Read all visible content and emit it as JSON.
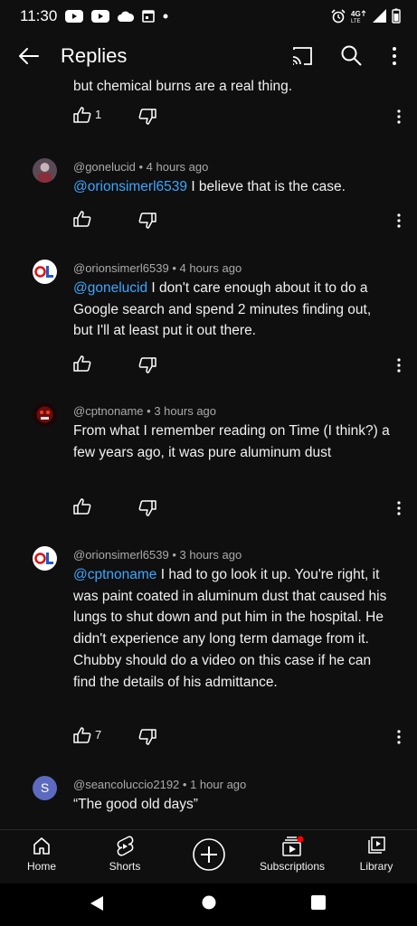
{
  "status_bar": {
    "time": "11:30",
    "network": "4G LTE"
  },
  "header": {
    "title": "Replies"
  },
  "comments": [
    {
      "author": "",
      "age": "",
      "body_parts": [
        {
          "t": "but chemical burns are a real thing.",
          "m": false
        }
      ],
      "likes": "1"
    },
    {
      "author": "@gonelucid",
      "age": "4 hours ago",
      "body_parts": [
        {
          "t": "@orionsimerl6539",
          "m": true
        },
        {
          "t": "  I believe that is the case.",
          "m": false
        }
      ],
      "likes": ""
    },
    {
      "author": "@orionsimerl6539",
      "age": "4 hours ago",
      "body_parts": [
        {
          "t": "@gonelucid",
          "m": true
        },
        {
          "t": "  I don't care enough about it to do a Google search and spend 2 minutes finding out, but I'll at least put it out there.",
          "m": false
        }
      ],
      "likes": ""
    },
    {
      "author": "@cptnoname",
      "age": "3 hours ago",
      "body_parts": [
        {
          "t": "From what I remember reading on Time (I think?) a few years ago, it was pure aluminum dust",
          "m": false
        }
      ],
      "likes": ""
    },
    {
      "author": "@orionsimerl6539",
      "age": "3 hours ago",
      "body_parts": [
        {
          "t": "@cptnoname",
          "m": true
        },
        {
          "t": "  I had to go look it up.  You're right, it was paint coated in aluminum dust that caused his lungs to shut down and put him in the hospital.  He didn't experience any long term damage from it.  Chubby should do a video on this case if he can find the details of his admittance.",
          "m": false
        }
      ],
      "likes": "7"
    },
    {
      "author": "@seancoluccio2192",
      "age": "1 hour ago",
      "body_parts": [
        {
          "t": "“The good old days”",
          "m": false
        }
      ],
      "likes": "",
      "avatar_letter": "S"
    }
  ],
  "meta_separator": "•",
  "bottom_nav": [
    {
      "label": "Home",
      "icon": "home-icon"
    },
    {
      "label": "Shorts",
      "icon": "shorts-icon"
    },
    {
      "label": "",
      "icon": "create-plus-icon"
    },
    {
      "label": "Subscriptions",
      "icon": "subscriptions-icon"
    },
    {
      "label": "Library",
      "icon": "library-icon"
    }
  ],
  "colors": {
    "background": "#0f0f0f",
    "mention": "#3ea6ff",
    "meta": "#aaaaaa",
    "notification_dot": "#ff0000"
  }
}
